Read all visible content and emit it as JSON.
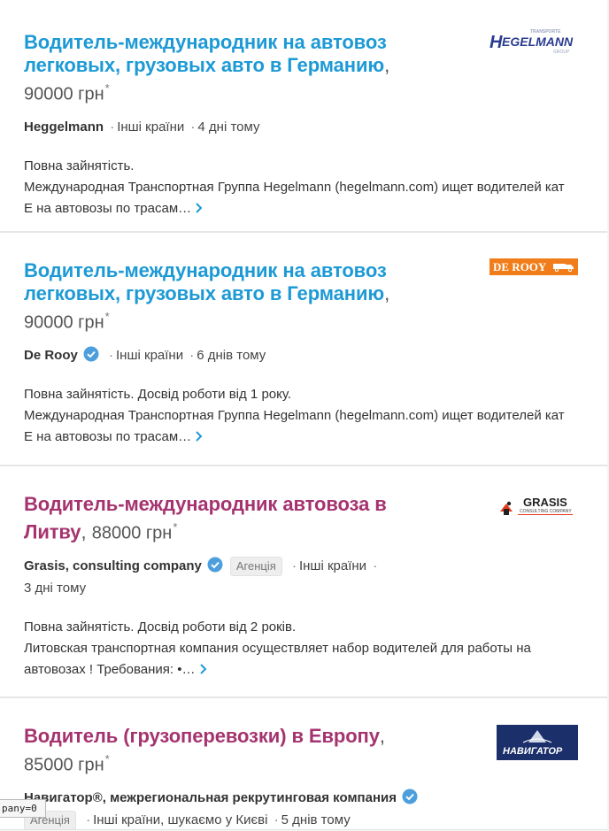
{
  "jobs": [
    {
      "title": "Водитель-международник на автовоз легковых, грузовых авто в Германию",
      "salary": "90000 грн",
      "company": "Heggelmann",
      "verified": false,
      "location": "Інші країни",
      "posted": "4 дні тому",
      "desc_line1": "Повна зайнятість.",
      "desc_line2": "Международная Транспортная Группа Hegelmann (hegelmann.com) ищет водителей кат Е на автовозы по трасам…",
      "logo": {
        "word": "EGELMANN",
        "mark": "H",
        "top": "TRANSPORTE",
        "sub": "GROUP"
      }
    },
    {
      "title": "Водитель-международник на автовоз легковых, грузовых авто в Германию",
      "salary": "90000 грн",
      "company": "De Rooy",
      "verified": true,
      "location": "Інші країни",
      "posted": "6 днів тому",
      "desc_line1": "Повна зайнятість. Досвід роботи від 1 року.",
      "desc_line2": "Международная Транспортная Группа Hegelmann (hegelmann.com) ищет водителей кат Е на автовозы по трасам…",
      "logo": {
        "word": "DE ROOY"
      }
    },
    {
      "title": "Водитель-международник автовоза в Литву",
      "salary": "88000 грн",
      "company": "Grasis, consulting company",
      "verified": true,
      "tag": "Агенція",
      "location": "Інші країни",
      "posted": "3 дні тому",
      "desc_line1": "Повна зайнятість. Досвід роботи від 2 років.",
      "desc_line2": "Литовская транспортная компания осуществляет набор водителей для работы на автовозах ! Требования: •…",
      "logo": {
        "word": "GRASIS",
        "sub": "CONSULTING COMPANY"
      }
    },
    {
      "title": "Водитель (грузоперевозки) в Европу",
      "salary": "85000 грн",
      "company": "Навигатор®, межрегиональная рекрутинговая компания",
      "verified": true,
      "tag": "Агенція",
      "location": "Інші країни",
      "extra": "шукаємо у Києві",
      "posted": "5 днів тому",
      "logo": {
        "word": "НАВИГАТОР"
      }
    }
  ],
  "salary_note": "*",
  "comma": ",",
  "separator": "·",
  "debug_text": "pany=0",
  "colors": {
    "link_blue": "#1d9ad6",
    "link_purple": "#a5336f",
    "verified": "#4c9fdc"
  }
}
